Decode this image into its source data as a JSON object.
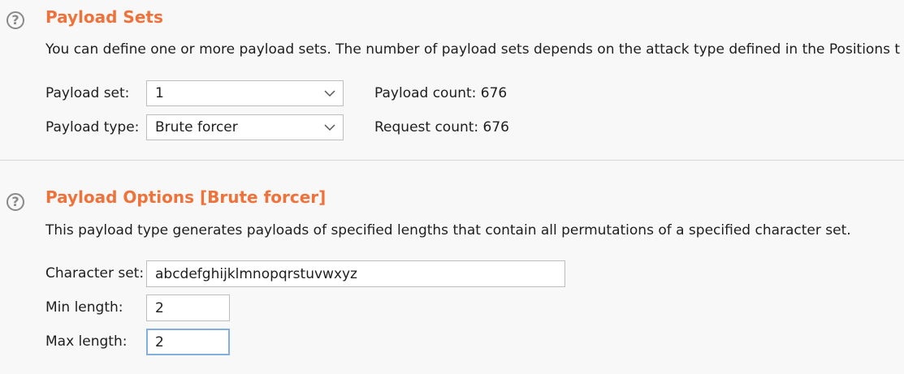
{
  "payload_sets": {
    "title": "Payload Sets",
    "description": "You can define one or more payload sets. The number of payload sets depends on the attack type defined in the Positions t",
    "payload_set_label": "Payload set:",
    "payload_set_value": "1",
    "payload_type_label": "Payload type:",
    "payload_type_value": "Brute forcer",
    "payload_count_label": "Payload count: 676",
    "request_count_label": "Request count: 676"
  },
  "payload_options": {
    "title": "Payload Options [Brute forcer]",
    "description": "This payload type generates payloads of specified lengths that contain all permutations of a specified character set.",
    "character_set_label": "Character set:",
    "character_set_value": "abcdefghijklmnopqrstuvwxyz",
    "min_length_label": "Min length:",
    "min_length_value": "2",
    "max_length_label": "Max length:",
    "max_length_value": "2"
  },
  "icons": {
    "help": "question-circle-icon",
    "dropdown": "chevron-down-icon"
  },
  "colors": {
    "title": "#f0723b",
    "focus_border": "#82aee0",
    "background": "#f8f8f8"
  }
}
